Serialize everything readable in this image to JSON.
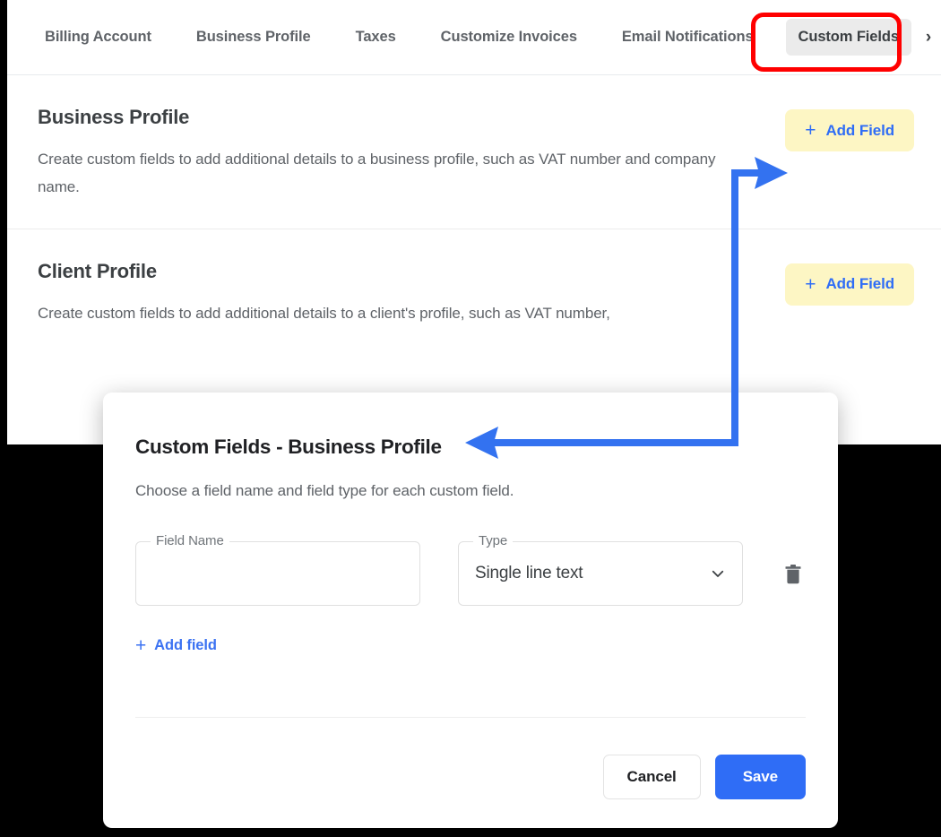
{
  "colors": {
    "accent_blue": "#2f6df6",
    "annotation_blue": "#3372f0",
    "annotation_red": "#ff0000",
    "highlight_yellow": "#fdf6c4",
    "active_tab_bg": "#ebebeb"
  },
  "tabs": {
    "items": [
      {
        "label": "Billing Account",
        "active": false
      },
      {
        "label": "Business Profile",
        "active": false
      },
      {
        "label": "Taxes",
        "active": false
      },
      {
        "label": "Customize Invoices",
        "active": false
      },
      {
        "label": "Email Notifications",
        "active": false
      },
      {
        "label": "Custom Fields",
        "active": true
      }
    ],
    "next_label": "›"
  },
  "sections": [
    {
      "title": "Business Profile",
      "description": "Create custom fields to add additional details to a business profile, such as VAT number and company name.",
      "button": {
        "plus": "+",
        "label": "Add Field"
      }
    },
    {
      "title": "Client Profile",
      "description": "Create custom fields to add additional details to a client's profile, such as VAT number,",
      "button": {
        "plus": "+",
        "label": "Add Field"
      }
    }
  ],
  "modal": {
    "title": "Custom Fields - Business Profile",
    "subtitle": "Choose a field name and field type for each custom field.",
    "rows": [
      {
        "name_label": "Field Name",
        "name_value": "",
        "name_placeholder": "",
        "type_label": "Type",
        "type_value": "Single line text"
      }
    ],
    "add_field_link": {
      "plus": "+",
      "label": "Add field"
    },
    "actions": {
      "cancel_label": "Cancel",
      "save_label": "Save"
    }
  }
}
